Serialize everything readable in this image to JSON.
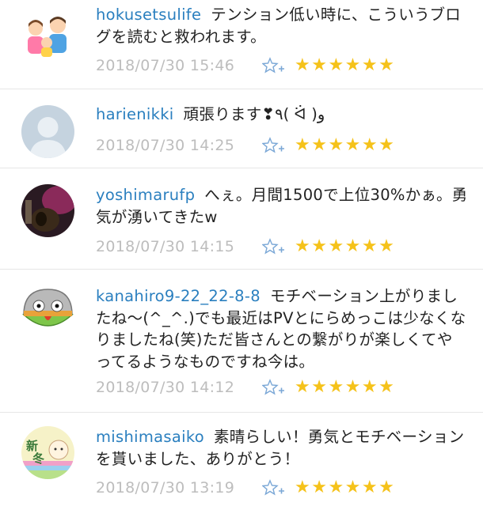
{
  "comments": [
    {
      "username": "hokusetsulife",
      "text": "テンション低い時に、こういうブログを読むと救われます。",
      "date": "2018/07/30 15:46",
      "stars": "★★★★★★",
      "avatar": "family-illustration"
    },
    {
      "username": "harienikki",
      "text": "頑張ります❣٩( ᐛ )و",
      "date": "2018/07/30 14:25",
      "stars": "★★★★★★",
      "avatar": "default-user-silhouette"
    },
    {
      "username": "yoshimarufp",
      "text": "へぇ。月間1500で上位30%かぁ。勇気が湧いてきたw",
      "date": "2018/07/30 14:15",
      "stars": "★★★★★★",
      "avatar": "guitar-photo"
    },
    {
      "username": "kanahiro9-22_22-8-8",
      "text": "モチベーション上がりましたね〜(^_^.)でも最近はPVとにらめっこは少なくなりましたね(笑)ただ皆さんとの繋がりが楽しくてやってるようなものですね今は。",
      "date": "2018/07/30 14:12",
      "stars": "★★★★★★",
      "avatar": "round-character"
    },
    {
      "username": "mishimasaiko",
      "text": "素晴らしい！勇気とモチベーションを貰いました、ありがとう！",
      "date": "2018/07/30 13:19",
      "stars": "★★★★★★",
      "avatar": "shinto-new-winter"
    }
  ],
  "avatar_text": {
    "new_winter": "新冬"
  },
  "colors": {
    "username": "#2a7fbf",
    "star": "#f5c21a",
    "date": "#bdbdbd",
    "add_star": "#7aa7d6"
  }
}
